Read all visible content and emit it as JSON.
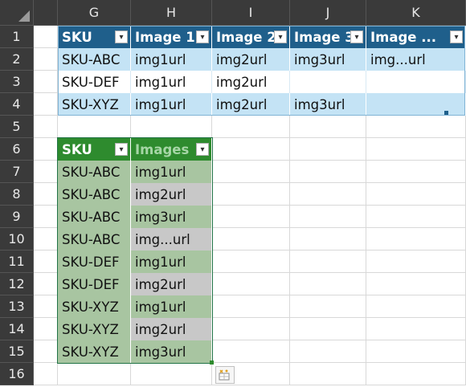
{
  "columns": [
    "G",
    "H",
    "I",
    "J",
    "K"
  ],
  "rows": [
    "1",
    "2",
    "3",
    "4",
    "5",
    "6",
    "7",
    "8",
    "9",
    "10",
    "11",
    "12",
    "13",
    "14",
    "15",
    "16"
  ],
  "table1": {
    "headers": [
      "SKU",
      "Image 1",
      "Image 2",
      "Image 3",
      "Image ..."
    ],
    "data": [
      [
        "SKU-ABC",
        "img1url",
        "img2url",
        "img3url",
        "img...url"
      ],
      [
        "SKU-DEF",
        "img1url",
        "img2url",
        "",
        ""
      ],
      [
        "SKU-XYZ",
        "img1url",
        "img2url",
        "img3url",
        ""
      ]
    ]
  },
  "table2": {
    "headers": [
      "SKU",
      "Images"
    ],
    "data": [
      [
        "SKU-ABC",
        "img1url"
      ],
      [
        "SKU-ABC",
        "img2url"
      ],
      [
        "SKU-ABC",
        "img3url"
      ],
      [
        "SKU-ABC",
        "img...url"
      ],
      [
        "SKU-DEF",
        "img1url"
      ],
      [
        "SKU-DEF",
        "img2url"
      ],
      [
        "SKU-XYZ",
        "img1url"
      ],
      [
        "SKU-XYZ",
        "img2url"
      ],
      [
        "SKU-XYZ",
        "img3url"
      ]
    ]
  },
  "colors": {
    "table1_header": "#1f5f8b",
    "table1_band": "#c4e3f5",
    "table2_header": "#2e8b2e",
    "table2_band_green": "#a8c5a1",
    "table2_band_grey": "#c8c8c8"
  },
  "icons": {
    "dropdown": "filter-dropdown-icon",
    "quick_analysis": "quick-analysis-icon",
    "select_all": "select-all-icon"
  }
}
